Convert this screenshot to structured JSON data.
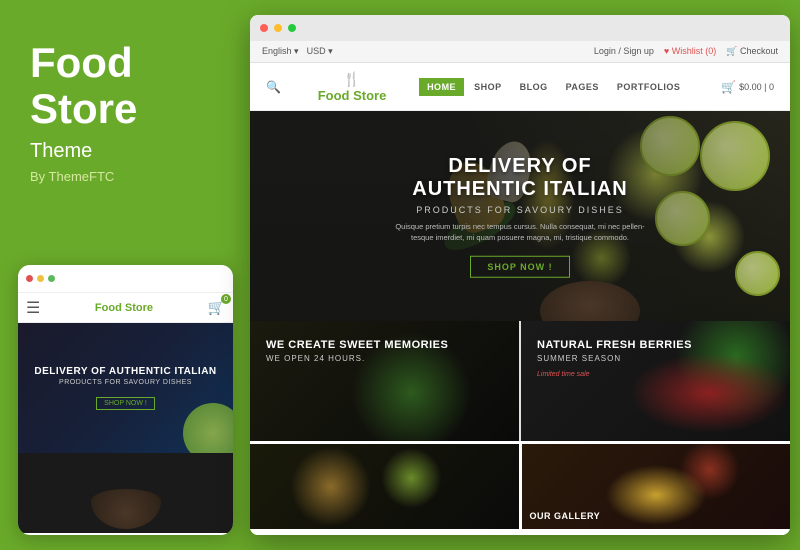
{
  "left": {
    "title_line1": "Food",
    "title_line2": "Store",
    "subtitle": "Theme",
    "by": "By ThemeFTC"
  },
  "mobile": {
    "dots": [
      "red",
      "yellow",
      "green"
    ],
    "logo": "Food Store",
    "cart_count": "0",
    "hero_title": "DELIVERY OF AUTHENTIC ITALIAN",
    "hero_sub": "PRODUCTS FOR SAVOURY DISHES",
    "shop_btn": "SHOP NOW !"
  },
  "browser": {
    "dots": [
      "red",
      "yellow",
      "green"
    ]
  },
  "util_bar": {
    "lang": "English",
    "lang_arrow": "▾",
    "currency": "USD",
    "currency_arrow": "▾",
    "login": "Login / Sign up",
    "wishlist": "♥ Wishlist (0)",
    "checkout": "🛒 Checkout"
  },
  "nav": {
    "logo_icon": "🍴",
    "logo_text_food": "Food",
    "logo_text_store": " Store",
    "menu": [
      "HOME",
      "SHOP",
      "BLOG",
      "PAGES",
      "PORTFOLIOS"
    ],
    "active_item": "HOME",
    "cart_icon": "🛒",
    "cart_amount": "$0.00 | 0"
  },
  "hero": {
    "title": "DELIVERY OF AUTHENTIC ITALIAN",
    "subtitle": "PRODUCTS FOR SAVOURY DISHES",
    "desc": "Quisque pretium turpis nec tempus cursus. Nulla consequat, mi nec pellen-tesque imerdiet, mi quam posuere magna, mi, tristique commodo.",
    "btn": "SHOP NOW !"
  },
  "cards": [
    {
      "title": "WE CREATE SWEET MEMORIES",
      "sub": "WE OPEN 24 HOURS."
    },
    {
      "title": "NATURAL FRESH BERRIES",
      "sub": "SUMMER SEASON",
      "badge": "Limited time sale"
    }
  ],
  "gallery": [
    {
      "label": ""
    },
    {
      "label": "OUR GALLERY"
    }
  ]
}
